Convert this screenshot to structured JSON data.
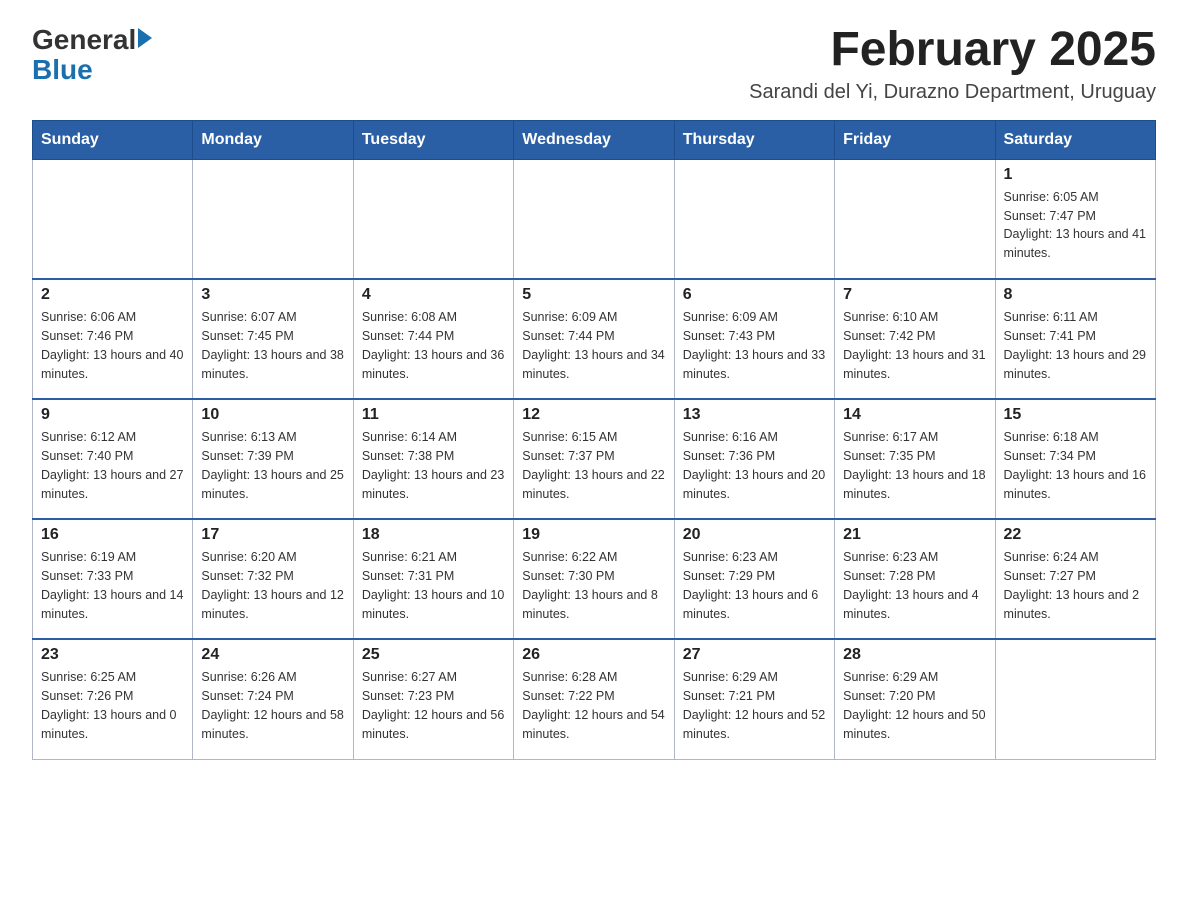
{
  "header": {
    "logo_general": "General",
    "logo_blue": "Blue",
    "month_title": "February 2025",
    "subtitle": "Sarandi del Yi, Durazno Department, Uruguay"
  },
  "days_of_week": [
    "Sunday",
    "Monday",
    "Tuesday",
    "Wednesday",
    "Thursday",
    "Friday",
    "Saturday"
  ],
  "weeks": [
    [
      {
        "day": "",
        "info": ""
      },
      {
        "day": "",
        "info": ""
      },
      {
        "day": "",
        "info": ""
      },
      {
        "day": "",
        "info": ""
      },
      {
        "day": "",
        "info": ""
      },
      {
        "day": "",
        "info": ""
      },
      {
        "day": "1",
        "info": "Sunrise: 6:05 AM\nSunset: 7:47 PM\nDaylight: 13 hours and 41 minutes."
      }
    ],
    [
      {
        "day": "2",
        "info": "Sunrise: 6:06 AM\nSunset: 7:46 PM\nDaylight: 13 hours and 40 minutes."
      },
      {
        "day": "3",
        "info": "Sunrise: 6:07 AM\nSunset: 7:45 PM\nDaylight: 13 hours and 38 minutes."
      },
      {
        "day": "4",
        "info": "Sunrise: 6:08 AM\nSunset: 7:44 PM\nDaylight: 13 hours and 36 minutes."
      },
      {
        "day": "5",
        "info": "Sunrise: 6:09 AM\nSunset: 7:44 PM\nDaylight: 13 hours and 34 minutes."
      },
      {
        "day": "6",
        "info": "Sunrise: 6:09 AM\nSunset: 7:43 PM\nDaylight: 13 hours and 33 minutes."
      },
      {
        "day": "7",
        "info": "Sunrise: 6:10 AM\nSunset: 7:42 PM\nDaylight: 13 hours and 31 minutes."
      },
      {
        "day": "8",
        "info": "Sunrise: 6:11 AM\nSunset: 7:41 PM\nDaylight: 13 hours and 29 minutes."
      }
    ],
    [
      {
        "day": "9",
        "info": "Sunrise: 6:12 AM\nSunset: 7:40 PM\nDaylight: 13 hours and 27 minutes."
      },
      {
        "day": "10",
        "info": "Sunrise: 6:13 AM\nSunset: 7:39 PM\nDaylight: 13 hours and 25 minutes."
      },
      {
        "day": "11",
        "info": "Sunrise: 6:14 AM\nSunset: 7:38 PM\nDaylight: 13 hours and 23 minutes."
      },
      {
        "day": "12",
        "info": "Sunrise: 6:15 AM\nSunset: 7:37 PM\nDaylight: 13 hours and 22 minutes."
      },
      {
        "day": "13",
        "info": "Sunrise: 6:16 AM\nSunset: 7:36 PM\nDaylight: 13 hours and 20 minutes."
      },
      {
        "day": "14",
        "info": "Sunrise: 6:17 AM\nSunset: 7:35 PM\nDaylight: 13 hours and 18 minutes."
      },
      {
        "day": "15",
        "info": "Sunrise: 6:18 AM\nSunset: 7:34 PM\nDaylight: 13 hours and 16 minutes."
      }
    ],
    [
      {
        "day": "16",
        "info": "Sunrise: 6:19 AM\nSunset: 7:33 PM\nDaylight: 13 hours and 14 minutes."
      },
      {
        "day": "17",
        "info": "Sunrise: 6:20 AM\nSunset: 7:32 PM\nDaylight: 13 hours and 12 minutes."
      },
      {
        "day": "18",
        "info": "Sunrise: 6:21 AM\nSunset: 7:31 PM\nDaylight: 13 hours and 10 minutes."
      },
      {
        "day": "19",
        "info": "Sunrise: 6:22 AM\nSunset: 7:30 PM\nDaylight: 13 hours and 8 minutes."
      },
      {
        "day": "20",
        "info": "Sunrise: 6:23 AM\nSunset: 7:29 PM\nDaylight: 13 hours and 6 minutes."
      },
      {
        "day": "21",
        "info": "Sunrise: 6:23 AM\nSunset: 7:28 PM\nDaylight: 13 hours and 4 minutes."
      },
      {
        "day": "22",
        "info": "Sunrise: 6:24 AM\nSunset: 7:27 PM\nDaylight: 13 hours and 2 minutes."
      }
    ],
    [
      {
        "day": "23",
        "info": "Sunrise: 6:25 AM\nSunset: 7:26 PM\nDaylight: 13 hours and 0 minutes."
      },
      {
        "day": "24",
        "info": "Sunrise: 6:26 AM\nSunset: 7:24 PM\nDaylight: 12 hours and 58 minutes."
      },
      {
        "day": "25",
        "info": "Sunrise: 6:27 AM\nSunset: 7:23 PM\nDaylight: 12 hours and 56 minutes."
      },
      {
        "day": "26",
        "info": "Sunrise: 6:28 AM\nSunset: 7:22 PM\nDaylight: 12 hours and 54 minutes."
      },
      {
        "day": "27",
        "info": "Sunrise: 6:29 AM\nSunset: 7:21 PM\nDaylight: 12 hours and 52 minutes."
      },
      {
        "day": "28",
        "info": "Sunrise: 6:29 AM\nSunset: 7:20 PM\nDaylight: 12 hours and 50 minutes."
      },
      {
        "day": "",
        "info": ""
      }
    ]
  ]
}
